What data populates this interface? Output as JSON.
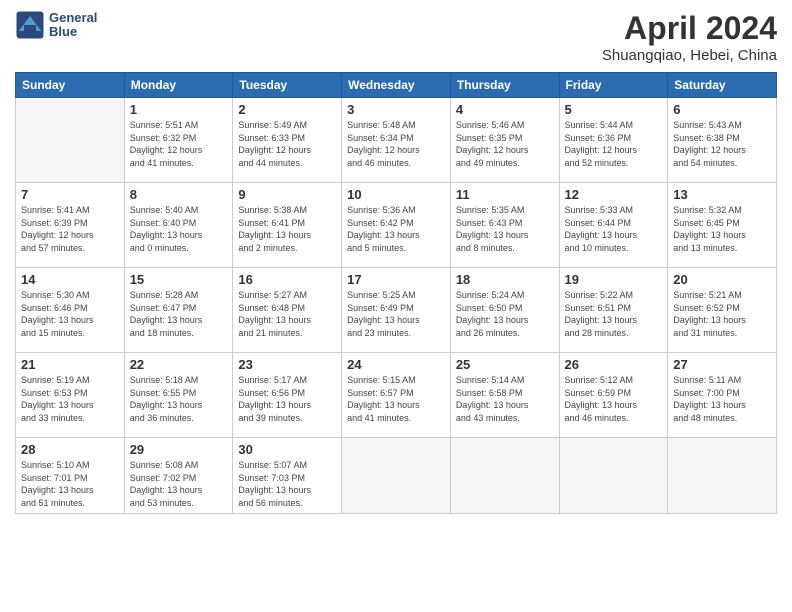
{
  "header": {
    "logo_line1": "General",
    "logo_line2": "Blue",
    "title": "April 2024",
    "subtitle": "Shuangqiao, Hebei, China"
  },
  "weekdays": [
    "Sunday",
    "Monday",
    "Tuesday",
    "Wednesday",
    "Thursday",
    "Friday",
    "Saturday"
  ],
  "weeks": [
    [
      {
        "day": "",
        "info": ""
      },
      {
        "day": "1",
        "info": "Sunrise: 5:51 AM\nSunset: 6:32 PM\nDaylight: 12 hours\nand 41 minutes."
      },
      {
        "day": "2",
        "info": "Sunrise: 5:49 AM\nSunset: 6:33 PM\nDaylight: 12 hours\nand 44 minutes."
      },
      {
        "day": "3",
        "info": "Sunrise: 5:48 AM\nSunset: 6:34 PM\nDaylight: 12 hours\nand 46 minutes."
      },
      {
        "day": "4",
        "info": "Sunrise: 5:46 AM\nSunset: 6:35 PM\nDaylight: 12 hours\nand 49 minutes."
      },
      {
        "day": "5",
        "info": "Sunrise: 5:44 AM\nSunset: 6:36 PM\nDaylight: 12 hours\nand 52 minutes."
      },
      {
        "day": "6",
        "info": "Sunrise: 5:43 AM\nSunset: 6:38 PM\nDaylight: 12 hours\nand 54 minutes."
      }
    ],
    [
      {
        "day": "7",
        "info": "Sunrise: 5:41 AM\nSunset: 6:39 PM\nDaylight: 12 hours\nand 57 minutes."
      },
      {
        "day": "8",
        "info": "Sunrise: 5:40 AM\nSunset: 6:40 PM\nDaylight: 13 hours\nand 0 minutes."
      },
      {
        "day": "9",
        "info": "Sunrise: 5:38 AM\nSunset: 6:41 PM\nDaylight: 13 hours\nand 2 minutes."
      },
      {
        "day": "10",
        "info": "Sunrise: 5:36 AM\nSunset: 6:42 PM\nDaylight: 13 hours\nand 5 minutes."
      },
      {
        "day": "11",
        "info": "Sunrise: 5:35 AM\nSunset: 6:43 PM\nDaylight: 13 hours\nand 8 minutes."
      },
      {
        "day": "12",
        "info": "Sunrise: 5:33 AM\nSunset: 6:44 PM\nDaylight: 13 hours\nand 10 minutes."
      },
      {
        "day": "13",
        "info": "Sunrise: 5:32 AM\nSunset: 6:45 PM\nDaylight: 13 hours\nand 13 minutes."
      }
    ],
    [
      {
        "day": "14",
        "info": "Sunrise: 5:30 AM\nSunset: 6:46 PM\nDaylight: 13 hours\nand 15 minutes."
      },
      {
        "day": "15",
        "info": "Sunrise: 5:28 AM\nSunset: 6:47 PM\nDaylight: 13 hours\nand 18 minutes."
      },
      {
        "day": "16",
        "info": "Sunrise: 5:27 AM\nSunset: 6:48 PM\nDaylight: 13 hours\nand 21 minutes."
      },
      {
        "day": "17",
        "info": "Sunrise: 5:25 AM\nSunset: 6:49 PM\nDaylight: 13 hours\nand 23 minutes."
      },
      {
        "day": "18",
        "info": "Sunrise: 5:24 AM\nSunset: 6:50 PM\nDaylight: 13 hours\nand 26 minutes."
      },
      {
        "day": "19",
        "info": "Sunrise: 5:22 AM\nSunset: 6:51 PM\nDaylight: 13 hours\nand 28 minutes."
      },
      {
        "day": "20",
        "info": "Sunrise: 5:21 AM\nSunset: 6:52 PM\nDaylight: 13 hours\nand 31 minutes."
      }
    ],
    [
      {
        "day": "21",
        "info": "Sunrise: 5:19 AM\nSunset: 6:53 PM\nDaylight: 13 hours\nand 33 minutes."
      },
      {
        "day": "22",
        "info": "Sunrise: 5:18 AM\nSunset: 6:55 PM\nDaylight: 13 hours\nand 36 minutes."
      },
      {
        "day": "23",
        "info": "Sunrise: 5:17 AM\nSunset: 6:56 PM\nDaylight: 13 hours\nand 39 minutes."
      },
      {
        "day": "24",
        "info": "Sunrise: 5:15 AM\nSunset: 6:57 PM\nDaylight: 13 hours\nand 41 minutes."
      },
      {
        "day": "25",
        "info": "Sunrise: 5:14 AM\nSunset: 6:58 PM\nDaylight: 13 hours\nand 43 minutes."
      },
      {
        "day": "26",
        "info": "Sunrise: 5:12 AM\nSunset: 6:59 PM\nDaylight: 13 hours\nand 46 minutes."
      },
      {
        "day": "27",
        "info": "Sunrise: 5:11 AM\nSunset: 7:00 PM\nDaylight: 13 hours\nand 48 minutes."
      }
    ],
    [
      {
        "day": "28",
        "info": "Sunrise: 5:10 AM\nSunset: 7:01 PM\nDaylight: 13 hours\nand 51 minutes."
      },
      {
        "day": "29",
        "info": "Sunrise: 5:08 AM\nSunset: 7:02 PM\nDaylight: 13 hours\nand 53 minutes."
      },
      {
        "day": "30",
        "info": "Sunrise: 5:07 AM\nSunset: 7:03 PM\nDaylight: 13 hours\nand 56 minutes."
      },
      {
        "day": "",
        "info": ""
      },
      {
        "day": "",
        "info": ""
      },
      {
        "day": "",
        "info": ""
      },
      {
        "day": "",
        "info": ""
      }
    ]
  ]
}
